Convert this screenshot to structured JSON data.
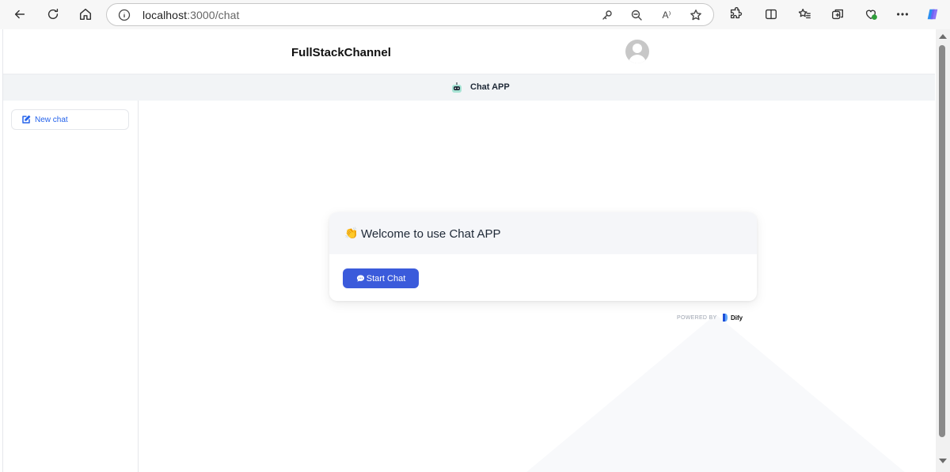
{
  "browser": {
    "url_host": "localhost",
    "url_path": ":3000/chat",
    "read_aloud_label": "A⁾"
  },
  "header": {
    "title": "FullStackChannel"
  },
  "app_bar": {
    "name": "Chat APP"
  },
  "sidebar": {
    "new_chat_label": "New chat"
  },
  "welcome": {
    "emoji": "👏",
    "title": "Welcome to use Chat APP",
    "start_label": "Start Chat"
  },
  "footer": {
    "powered_by": "POWERED BY",
    "brand": "Dify"
  },
  "colors": {
    "accent": "#3b5bdb",
    "link": "#2563eb"
  }
}
